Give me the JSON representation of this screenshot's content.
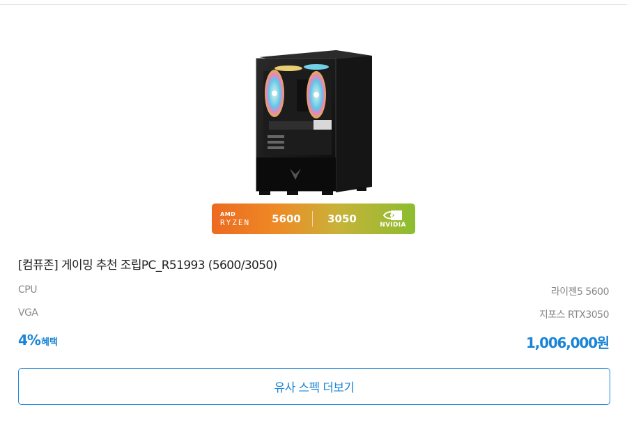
{
  "badge": {
    "cpu_brand_top": "AMD",
    "cpu_brand_bottom": "RYZEN",
    "cpu_model": "5600",
    "gpu_model": "3050",
    "gpu_brand": "NVIDIA"
  },
  "product": {
    "title": "[컴퓨존] 게이밍 추천 조립PC_R51993 (5600/3050)"
  },
  "specs": [
    {
      "label": "CPU",
      "value": "라이젠5 5600"
    },
    {
      "label": "VGA",
      "value": "지포스 RTX3050"
    }
  ],
  "benefit": {
    "percent": "4%",
    "label": "혜택"
  },
  "price": "1,006,000원",
  "more_button": "유사 스펙 더보기",
  "colors": {
    "accent": "#1a84d6",
    "badge_start": "#ec6a21",
    "badge_end": "#8cbd2f"
  }
}
